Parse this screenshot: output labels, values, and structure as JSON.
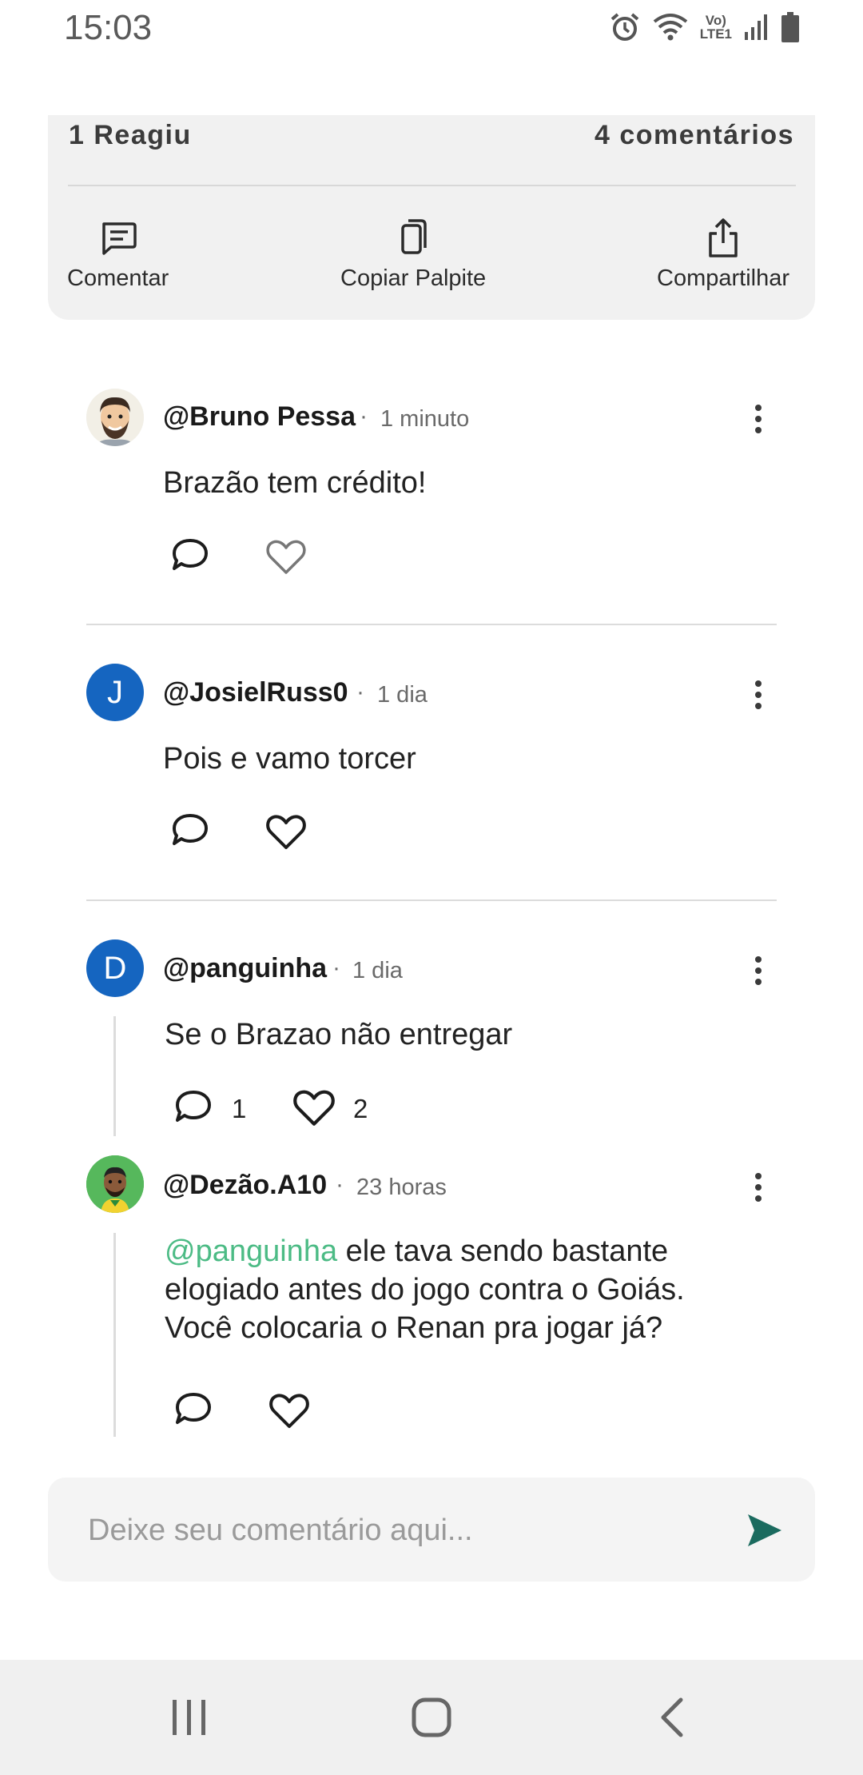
{
  "status_bar": {
    "time": "15:03",
    "icons": [
      "alarm-icon",
      "wifi-icon",
      "volte-lte-icon",
      "signal-icon",
      "battery-icon"
    ],
    "volte_label": "Vo)",
    "lte_label": "LTE1"
  },
  "reactions": {
    "reacted_label": "1 Reagiu",
    "comments_label": "4 comentários"
  },
  "actions": {
    "comment": "Comentar",
    "copy": "Copiar Palpite",
    "share": "Compartilhar"
  },
  "comments": [
    {
      "username": "@Bruno Pessa",
      "time": "1 minuto",
      "text": "Brazão tem crédito!",
      "avatar": "cartoon-avatar-bearded-man"
    },
    {
      "username": "@JosielRuss0",
      "time": "1 dia",
      "text": "Pois e vamo torcer",
      "avatar_letter": "J"
    },
    {
      "username": "@panguinha",
      "time": "1 dia",
      "text": "Se o Brazao não entregar",
      "avatar_letter": "D",
      "reply_count": "1",
      "like_count": "2"
    },
    {
      "username": "@Dezão.A10",
      "time": "23 horas",
      "mention": "@panguinha",
      "text_line1": " ele tava sendo bastante",
      "text_line2": "elogiado antes do jogo contra o Goiás.",
      "text_line3": "Você colocaria o Renan pra jogar já?",
      "avatar": "cartoon-avatar-soccer-player"
    }
  ],
  "input": {
    "placeholder": "Deixe seu comentário aqui..."
  },
  "colors": {
    "accent_mention": "#4cbb85",
    "send_button": "#1b6b5f",
    "avatar_letter_bg": "#1565c0"
  },
  "nav_bar": [
    "recents-icon",
    "home-icon",
    "back-icon"
  ]
}
